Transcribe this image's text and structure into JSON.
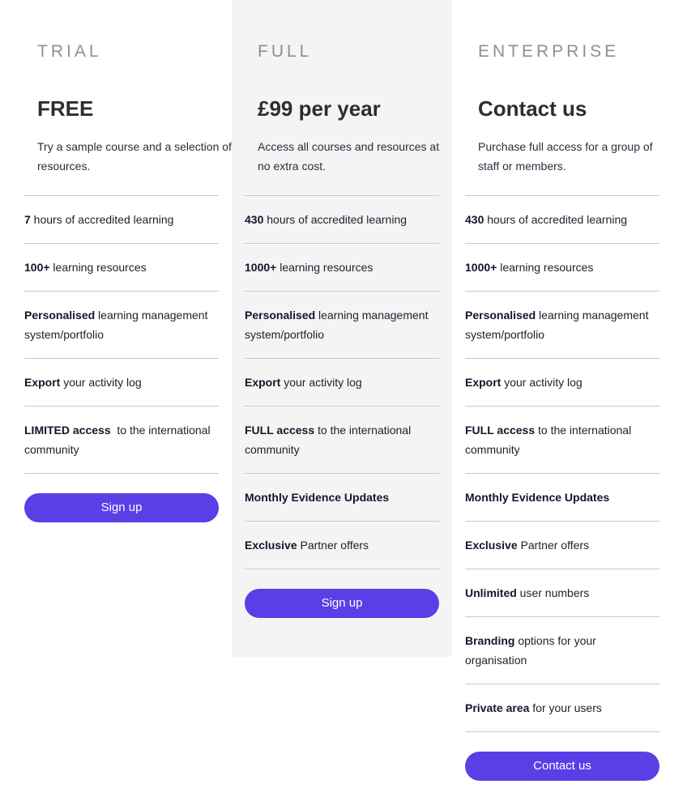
{
  "plans": [
    {
      "tier": "TRIAL",
      "price": "FREE",
      "description": "Try a sample course and a selection of resources.",
      "features": [
        {
          "bold": "7",
          "text": " hours of accredited learning"
        },
        {
          "bold": "100+",
          "text": " learning resources"
        },
        {
          "bold": "Personalised",
          "text": " learning management system/portfolio"
        },
        {
          "bold": "Export",
          "text": " your activity log"
        },
        {
          "bold": "LIMITED access",
          "text": "  to the international community"
        }
      ],
      "button_label": "Sign up"
    },
    {
      "tier": "FULL",
      "price": "£99 per year",
      "description": "Access all courses and resources at no extra cost.",
      "features": [
        {
          "bold": "430",
          "text": " hours of accredited learning"
        },
        {
          "bold": "1000+",
          "text": " learning resources"
        },
        {
          "bold": "Personalised",
          "text": " learning management system/portfolio"
        },
        {
          "bold": "Export",
          "text": " your activity log"
        },
        {
          "bold": "FULL access",
          "text": " to the international community"
        },
        {
          "bold": "Monthly Evidence Updates",
          "text": ""
        },
        {
          "bold": "Exclusive",
          "text": " Partner offers"
        }
      ],
      "button_label": "Sign up"
    },
    {
      "tier": "ENTERPRISE",
      "price": "Contact us",
      "description": "Purchase full access for a group of staff or members.",
      "features": [
        {
          "bold": "430",
          "text": " hours of accredited learning"
        },
        {
          "bold": "1000+",
          "text": " learning resources"
        },
        {
          "bold": "Personalised",
          "text": " learning management system/portfolio"
        },
        {
          "bold": "Export",
          "text": " your activity log"
        },
        {
          "bold": "FULL access",
          "text": " to the international community"
        },
        {
          "bold": "Monthly Evidence Updates",
          "text": ""
        },
        {
          "bold": "Exclusive",
          "text": " Partner offers"
        },
        {
          "bold": "Unlimited",
          "text": " user numbers"
        },
        {
          "bold": "Branding",
          "text": " options for your organisation"
        },
        {
          "bold": "Private area",
          "text": " for your users"
        }
      ],
      "button_label": "Contact us"
    }
  ],
  "colors": {
    "accent": "#5a3ee6",
    "highlight_background": "#f4f4f5",
    "tier_label": "#8f8f8f",
    "divider": "#c4cad3"
  }
}
